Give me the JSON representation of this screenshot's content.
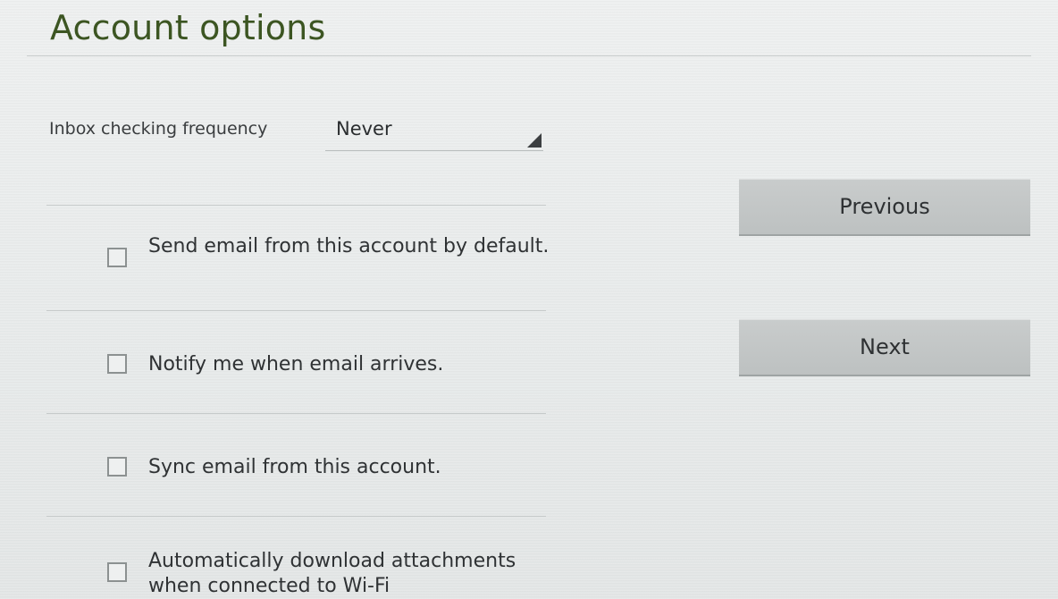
{
  "header": {
    "title": "Account options"
  },
  "frequency": {
    "label": "Inbox checking frequency",
    "selected": "Never"
  },
  "options": [
    {
      "label": "Send email from this account by default.",
      "checked": false
    },
    {
      "label": "Notify me when email arrives.",
      "checked": false
    },
    {
      "label": "Sync email from this account.",
      "checked": false
    },
    {
      "label": "Automatically download attachments when connected to Wi-Fi",
      "checked": false
    }
  ],
  "buttons": {
    "previous": "Previous",
    "next": "Next"
  },
  "colors": {
    "title": "#3c5522",
    "background": "#e9ecec",
    "button": "#c4c7c7"
  }
}
